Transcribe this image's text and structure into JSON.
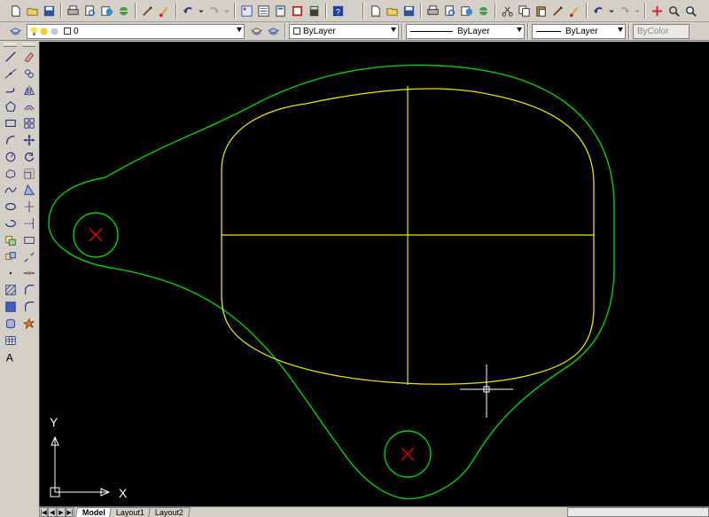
{
  "toolbar_standard": {
    "left_icons": [
      "new-icon",
      "open-icon",
      "save-icon",
      "print-icon",
      "plot-preview-icon",
      "publish-icon",
      "3d-dwf-icon",
      "matchprop-icon",
      "brush-icon",
      "undo-icon",
      "redo-icon",
      "designcenter-icon",
      "properties-icon",
      "toolpalettes-icon",
      "markup-icon",
      "quickcalc-icon",
      "help-icon"
    ],
    "right_icons": [
      "new-icon",
      "open-icon",
      "save-icon",
      "print-icon",
      "plot-preview-icon",
      "publish-icon",
      "3d-dwf-icon",
      "cut-icon",
      "copy-icon",
      "paste-icon",
      "matchprop-icon",
      "brush-icon",
      "undo-icon",
      "redo-icon",
      "pan-icon",
      "zoom-realtime-icon",
      "zoom-window-icon"
    ]
  },
  "layer_bar": {
    "current_layer": "0",
    "color_value": "ByLayer",
    "linetype_value": "ByLayer",
    "lineweight_value": "ByLayer",
    "plotstyle_value": "ByColor"
  },
  "draw_toolbar": [
    "line-icon",
    "construction-line-icon",
    "polyline-icon",
    "polygon-icon",
    "rectangle-icon",
    "arc-icon",
    "circle-icon",
    "revision-cloud-icon",
    "spline-icon",
    "ellipse-icon",
    "ellipse-arc-icon",
    "insert-block-icon",
    "make-block-icon",
    "point-icon",
    "hatch-icon",
    "gradient-icon",
    "region-icon",
    "table-icon",
    "multiline-text-icon"
  ],
  "modify_toolbar": [
    "erase-icon",
    "copy-object-icon",
    "mirror-icon",
    "offset-icon",
    "array-icon",
    "move-icon",
    "rotate-icon",
    "scale-icon",
    "stretch-icon",
    "trim-icon",
    "extend-icon",
    "break-at-point-icon",
    "break-icon",
    "join-icon",
    "chamfer-icon",
    "fillet-icon",
    "explode-icon"
  ],
  "drawing": {
    "background": "#000000",
    "outline_color": "#00d400",
    "inner_shape_color": "#e6e600",
    "center_mark_color": "#e00000",
    "crosshair_color": "#ffffff",
    "ucs_color": "#ffffff",
    "ucs_x_label": "X",
    "ucs_y_label": "Y"
  },
  "tabs": {
    "model": "Model",
    "layout1": "Layout1",
    "layout2": "Layout2"
  }
}
